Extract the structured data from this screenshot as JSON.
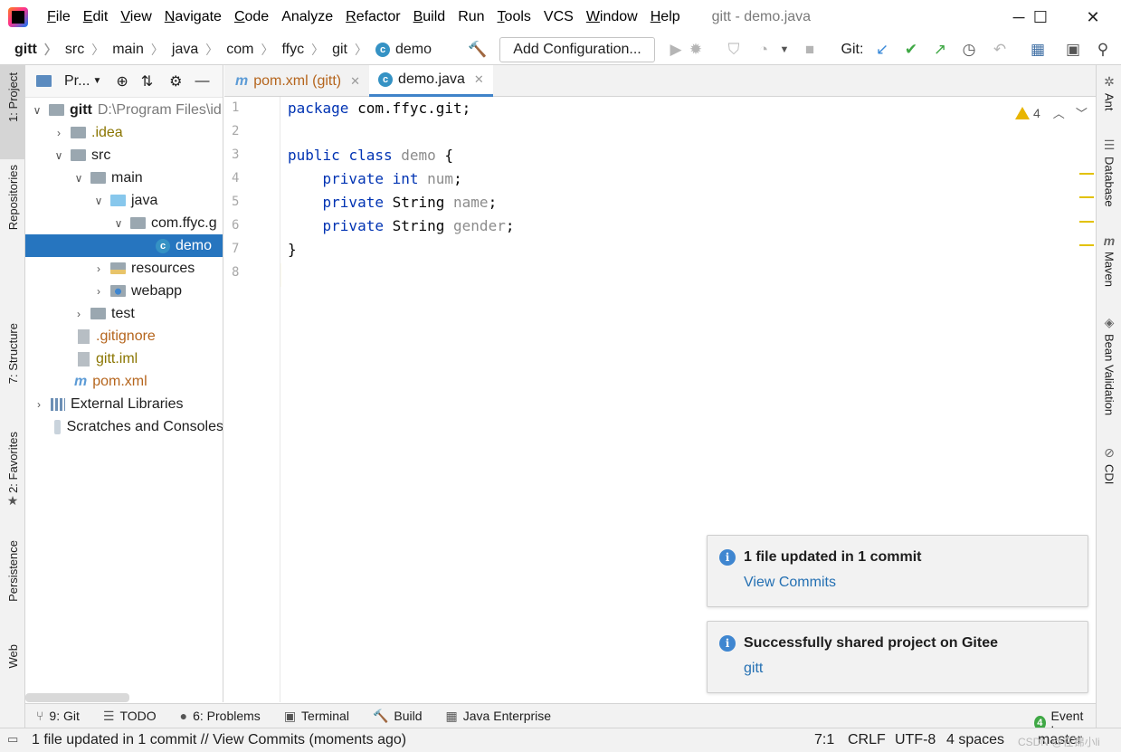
{
  "window": {
    "title": "gitt - demo.java",
    "controls": {
      "minimize": "─",
      "maximize": "☐",
      "close": "✕"
    }
  },
  "menu": [
    {
      "label": "File",
      "mnemonic": "F",
      "rest": "ile"
    },
    {
      "label": "Edit",
      "mnemonic": "E",
      "rest": "dit"
    },
    {
      "label": "View",
      "mnemonic": "V",
      "rest": "iew"
    },
    {
      "label": "Navigate",
      "mnemonic": "N",
      "rest": "avigate"
    },
    {
      "label": "Code",
      "mnemonic": "C",
      "rest": "ode"
    },
    {
      "label": "Analyze",
      "mnemonic": "",
      "rest": "Analyze"
    },
    {
      "label": "Refactor",
      "mnemonic": "R",
      "rest": "efactor"
    },
    {
      "label": "Build",
      "mnemonic": "B",
      "rest": "uild"
    },
    {
      "label": "Run",
      "mnemonic": "",
      "rest": "Run"
    },
    {
      "label": "Tools",
      "mnemonic": "T",
      "rest": "ools"
    },
    {
      "label": "VCS",
      "mnemonic": "",
      "rest": "VCS"
    },
    {
      "label": "Window",
      "mnemonic": "W",
      "rest": "indow"
    },
    {
      "label": "Help",
      "mnemonic": "H",
      "rest": "elp"
    }
  ],
  "breadcrumb": [
    "gitt",
    "src",
    "main",
    "java",
    "com",
    "ffyc",
    "git",
    "demo"
  ],
  "toolbar": {
    "add_configuration": "Add Configuration...",
    "git_label": "Git:"
  },
  "left_strip": {
    "project": "1: Project",
    "repositories": "Repositories",
    "structure": "7: Structure",
    "favorites": "2: Favorites",
    "persistence": "Persistence",
    "web": "Web"
  },
  "project_panel": {
    "title": "Pr...",
    "tree": [
      {
        "label": "gitt",
        "suffix": "D:\\Program Files\\id",
        "level": 0
      },
      {
        "label": ".idea",
        "level": 1
      },
      {
        "label": "src",
        "level": 1
      },
      {
        "label": "main",
        "level": 2
      },
      {
        "label": "java",
        "level": 3
      },
      {
        "label": "com.ffyc.g",
        "level": 4
      },
      {
        "label": "demo",
        "level": 5
      },
      {
        "label": "resources",
        "level": 3
      },
      {
        "label": "webapp",
        "level": 3
      },
      {
        "label": "test",
        "level": 2
      },
      {
        "label": ".gitignore",
        "level": 2
      },
      {
        "label": "gitt.iml",
        "level": 2
      },
      {
        "label": "pom.xml",
        "level": 2
      },
      {
        "label": "External Libraries",
        "level": 0
      },
      {
        "label": "Scratches and Consoles",
        "level": 0
      }
    ]
  },
  "tabs": [
    {
      "label": "pom.xml (gitt)",
      "active": false
    },
    {
      "label": "demo.java",
      "active": true
    }
  ],
  "editor": {
    "line_numbers": [
      "1",
      "2",
      "3",
      "4",
      "5",
      "6",
      "7",
      "8"
    ],
    "lines": {
      "l1_kw": "package",
      "l1_rest": " com.ffyc.git;",
      "l3_kw1": "public",
      "l3_kw2": "class",
      "l3_name": "demo",
      "l3_rest": " {",
      "l4_kw1": "private",
      "l4_kw2": "int",
      "l4_name": "num",
      "l4_rest": ";",
      "l5_kw": "private",
      "l5_type": " String ",
      "l5_name": "name",
      "l5_rest": ";",
      "l6_kw": "private",
      "l6_type": " String ",
      "l6_name": "gender",
      "l6_rest": ";",
      "l7": "}"
    },
    "warnings_count": "4"
  },
  "right_strip": {
    "ant": "Ant",
    "database": "Database",
    "maven": "Maven",
    "bean_validation": "Bean Validation",
    "cdi": "CDI"
  },
  "notifications": [
    {
      "title": "1 file updated in 1 commit",
      "link": "View Commits"
    },
    {
      "title": "Successfully shared project on Gitee",
      "link": "gitt"
    }
  ],
  "bottom_tabs": {
    "git": "9: Git",
    "todo": "TODO",
    "problems": "6: Problems",
    "terminal": "Terminal",
    "build": "Build",
    "java_enterprise": "Java Enterprise",
    "event_log": "Event Log",
    "event_count": "4"
  },
  "status": {
    "message": "1 file updated in 1 commit // View Commits (moments ago)",
    "position": "7:1",
    "line_sep": "CRLF",
    "encoding": "UTF-8",
    "indent": "4 spaces",
    "branch": "master",
    "watermark": "CSDN @在锦小li"
  },
  "colors": {
    "selection": "#2675bf",
    "keyword": "#0033b3",
    "link": "#2470b3",
    "info": "#3f86d0"
  }
}
